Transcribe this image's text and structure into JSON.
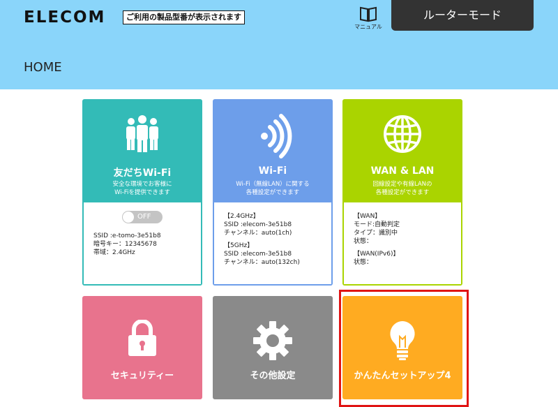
{
  "header": {
    "logo": "ELECOM",
    "model_notice": "ご利用の製品型番が表示されます",
    "manual_label": "マニュアル",
    "mode_button": "ルーターモード",
    "page_title": "HOME"
  },
  "cards": [
    {
      "title": "友だちWi-Fi",
      "desc1": "安全な環境でお客様に",
      "desc2": "Wi-Fiを提供できます",
      "toggle": "OFF",
      "lines": [
        "SSID :e-tomo-3e51b8",
        "暗号キー：12345678",
        "帯域：2.4GHz"
      ]
    },
    {
      "title": "Wi-Fi",
      "desc1": "Wi-Fi（無線LAN）に関する",
      "desc2": "各種設定ができます",
      "lines": [
        "【2.4GHz】",
        "SSID :elecom-3e51b8",
        "チャンネル：auto(1ch)",
        "【5GHz】",
        "SSID :elecom-3e51b8",
        "チャンネル：auto(132ch)"
      ]
    },
    {
      "title": "WAN & LAN",
      "desc1": "回線設定や有線LANの",
      "desc2": "各種設定ができます",
      "lines": [
        "【WAN】",
        "モード:自動判定",
        "タイプ：識別中",
        "状態：",
        "【WAN(IPv6)】",
        "状態："
      ]
    }
  ],
  "tiles": [
    {
      "title": "セキュリティー",
      "icon": "lock-icon"
    },
    {
      "title": "その他設定",
      "icon": "gear-icon"
    },
    {
      "title": "かんたんセットアップ4",
      "icon": "lightbulb-icon"
    }
  ]
}
